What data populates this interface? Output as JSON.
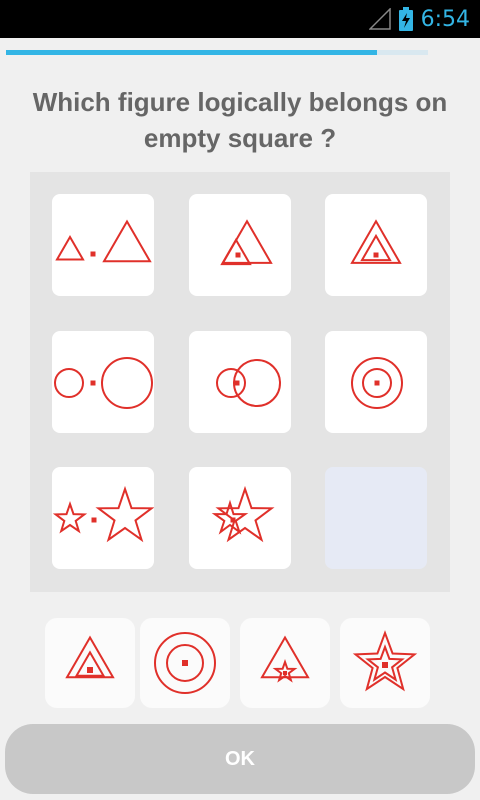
{
  "status_bar": {
    "time": "6:54",
    "icons": [
      "signal-icon",
      "battery-charging-icon"
    ],
    "clock_color": "#33b5e5"
  },
  "progress": {
    "value": 0.88,
    "color": "#33b5e5"
  },
  "question": "Which figure logically belongs on empty square ?",
  "figure_color": "#e0302a",
  "puzzle_grid": {
    "rows": [
      [
        "triangle-separate",
        "triangle-overlap",
        "triangle-concentric"
      ],
      [
        "circle-separate",
        "circle-overlap",
        "circle-concentric"
      ],
      [
        "star-separate",
        "star-overlap",
        "empty"
      ]
    ]
  },
  "answer_options": [
    "triangle-concentric",
    "circle-concentric",
    "triangle-with-star",
    "star-concentric"
  ],
  "ok_button": {
    "label": "OK",
    "enabled": false
  }
}
